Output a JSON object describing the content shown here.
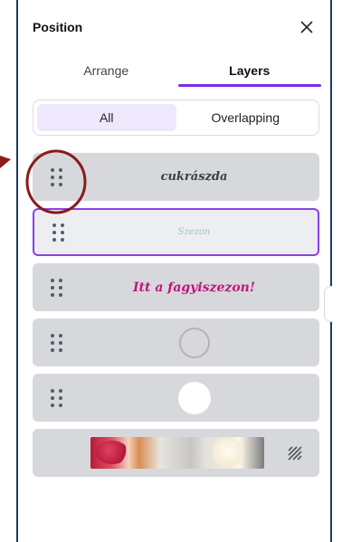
{
  "panel": {
    "title": "Position"
  },
  "tabs": [
    {
      "label": "Arrange",
      "active": false
    },
    {
      "label": "Layers",
      "active": true
    }
  ],
  "filter": {
    "options": [
      {
        "label": "All",
        "active": true
      },
      {
        "label": "Overlapping",
        "active": false
      }
    ]
  },
  "layers": [
    {
      "kind": "text",
      "text": "cukrászda",
      "selected": false
    },
    {
      "kind": "text",
      "text": "Szezon",
      "selected": true
    },
    {
      "kind": "text",
      "text": "Itt a fagyiszezon!",
      "selected": false
    },
    {
      "kind": "shape",
      "icon": "ring-shape",
      "selected": false
    },
    {
      "kind": "shape",
      "icon": "circle-shape",
      "selected": false
    },
    {
      "kind": "image",
      "icon": "background-photo",
      "selected": false
    }
  ],
  "colors": {
    "accent": "#7d2ae8",
    "layer_bg": "#d6d8dc",
    "annotation": "#8b1a1a"
  }
}
